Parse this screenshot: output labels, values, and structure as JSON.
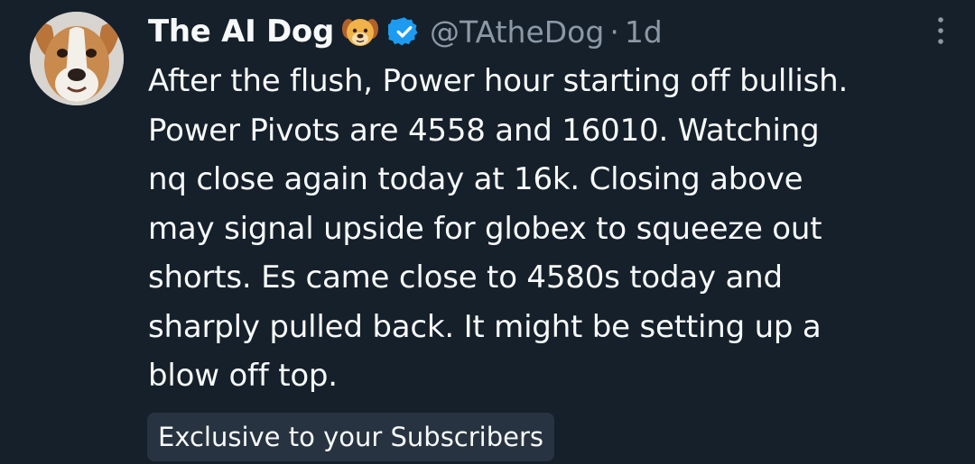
{
  "tweet": {
    "display_name": "The AI Dog",
    "name_emoji": "dog-face-emoji",
    "verified_icon": "verified-badge-icon",
    "handle": "@TAtheDog",
    "separator": "·",
    "timestamp": "1d",
    "more_icon": "more-vertical-icon",
    "body_lines": [
      "After the flush, Power hour starting off bullish.",
      "Power Pivots are 4558 and 16010. Watching",
      "nq close again today at 16k. Closing above",
      "may signal upside for globex to squeeze out",
      "shorts. Es came close to 4580s today and",
      "sharply pulled back. It might be setting up a",
      "blow off top."
    ],
    "subscriber_badge": "Exclusive to your Subscribers"
  },
  "colors": {
    "background": "#15202b",
    "primary_text": "#f7f9f9",
    "secondary_text": "#8b98a5",
    "verified_blue": "#1d9bf0",
    "badge_background": "#273340"
  }
}
